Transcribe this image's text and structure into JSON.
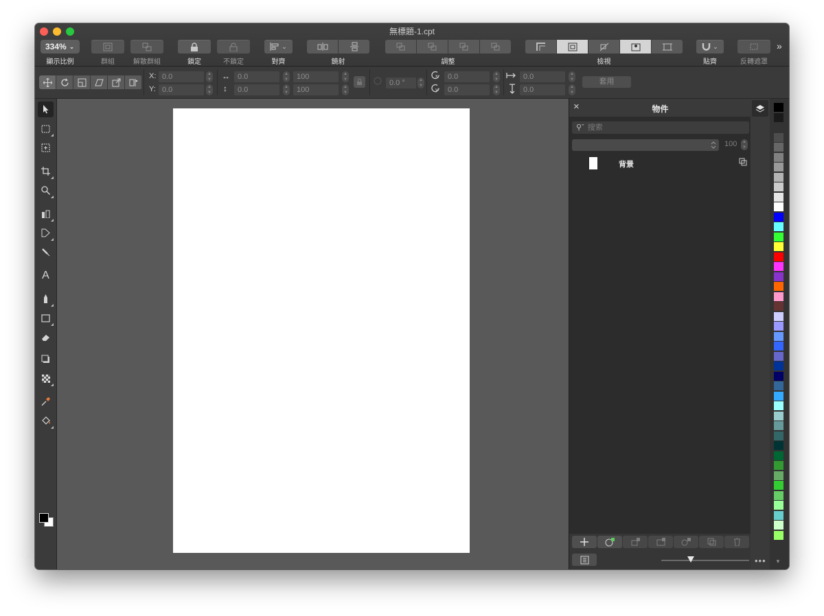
{
  "window": {
    "title": "無標題-1.cpt"
  },
  "toolbar": {
    "zoom_value": "334%",
    "zoom_label": "顯示比例",
    "group_label": "群組",
    "ungroup_label": "解散群組",
    "lock_label": "鎖定",
    "unlock_label": "不鎖定",
    "align_label": "對齊",
    "mirror_label": "鏡射",
    "arrange_label": "調整",
    "view_label": "檢視",
    "snap_label": "貼齊",
    "invert_mask_label": "反轉遮罩",
    "overflow_label": "»"
  },
  "propbar": {
    "x_label": "X:",
    "y_label": "Y:",
    "x_value": "0.0",
    "y_value": "0.0",
    "w_value": "0.0",
    "h_value": "0.0",
    "w_percent": "100",
    "h_percent": "100",
    "angle_value": "0.0 °",
    "cx_value": "0.0",
    "cy_value": "0.0",
    "skew_h_value": "0.0",
    "skew_v_value": "0.0",
    "apply_label": "套用"
  },
  "docker": {
    "title": "物件",
    "search_placeholder": "搜索",
    "opacity_value": "100",
    "layer_name": "背景"
  },
  "palette": {
    "colors": [
      "#000000",
      "#1a1a1a",
      "#333333",
      "#4d4d4d",
      "#666666",
      "#808080",
      "#999999",
      "#b3b3b3",
      "#cccccc",
      "#e6e6e6",
      "#ffffff",
      "#0000ff",
      "#66ffff",
      "#33ff33",
      "#ffff33",
      "#ff0000",
      "#ff33ff",
      "#8833cc",
      "#ff6600",
      "#ff99cc",
      "#663333",
      "#ccccff",
      "#9999ff",
      "#6699ff",
      "#3366ff",
      "#6666cc",
      "#003399",
      "#000066",
      "#336699",
      "#33aaff",
      "#99ffff",
      "#99cccc",
      "#669999",
      "#336666",
      "#003333",
      "#006633",
      "#339933",
      "#66aa66",
      "#33cc33",
      "#66cc66",
      "#99ff99",
      "#66cccc",
      "#ccffcc",
      "#99ff66"
    ]
  }
}
